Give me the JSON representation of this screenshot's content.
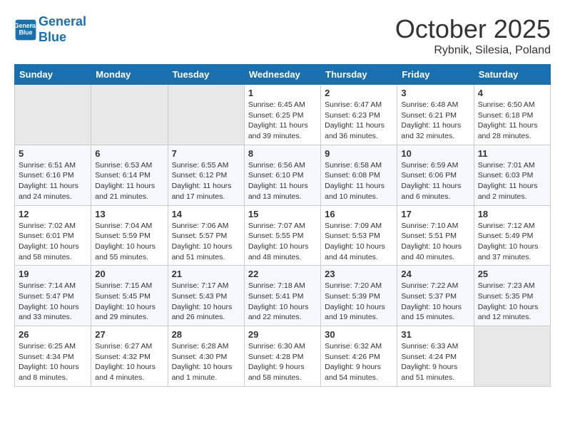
{
  "header": {
    "logo_line1": "General",
    "logo_line2": "Blue",
    "month": "October 2025",
    "location": "Rybnik, Silesia, Poland"
  },
  "weekdays": [
    "Sunday",
    "Monday",
    "Tuesday",
    "Wednesday",
    "Thursday",
    "Friday",
    "Saturday"
  ],
  "weeks": [
    [
      {
        "day": "",
        "info": ""
      },
      {
        "day": "",
        "info": ""
      },
      {
        "day": "",
        "info": ""
      },
      {
        "day": "1",
        "info": "Sunrise: 6:45 AM\nSunset: 6:25 PM\nDaylight: 11 hours\nand 39 minutes."
      },
      {
        "day": "2",
        "info": "Sunrise: 6:47 AM\nSunset: 6:23 PM\nDaylight: 11 hours\nand 36 minutes."
      },
      {
        "day": "3",
        "info": "Sunrise: 6:48 AM\nSunset: 6:21 PM\nDaylight: 11 hours\nand 32 minutes."
      },
      {
        "day": "4",
        "info": "Sunrise: 6:50 AM\nSunset: 6:18 PM\nDaylight: 11 hours\nand 28 minutes."
      }
    ],
    [
      {
        "day": "5",
        "info": "Sunrise: 6:51 AM\nSunset: 6:16 PM\nDaylight: 11 hours\nand 24 minutes."
      },
      {
        "day": "6",
        "info": "Sunrise: 6:53 AM\nSunset: 6:14 PM\nDaylight: 11 hours\nand 21 minutes."
      },
      {
        "day": "7",
        "info": "Sunrise: 6:55 AM\nSunset: 6:12 PM\nDaylight: 11 hours\nand 17 minutes."
      },
      {
        "day": "8",
        "info": "Sunrise: 6:56 AM\nSunset: 6:10 PM\nDaylight: 11 hours\nand 13 minutes."
      },
      {
        "day": "9",
        "info": "Sunrise: 6:58 AM\nSunset: 6:08 PM\nDaylight: 11 hours\nand 10 minutes."
      },
      {
        "day": "10",
        "info": "Sunrise: 6:59 AM\nSunset: 6:06 PM\nDaylight: 11 hours\nand 6 minutes."
      },
      {
        "day": "11",
        "info": "Sunrise: 7:01 AM\nSunset: 6:03 PM\nDaylight: 11 hours\nand 2 minutes."
      }
    ],
    [
      {
        "day": "12",
        "info": "Sunrise: 7:02 AM\nSunset: 6:01 PM\nDaylight: 10 hours\nand 58 minutes."
      },
      {
        "day": "13",
        "info": "Sunrise: 7:04 AM\nSunset: 5:59 PM\nDaylight: 10 hours\nand 55 minutes."
      },
      {
        "day": "14",
        "info": "Sunrise: 7:06 AM\nSunset: 5:57 PM\nDaylight: 10 hours\nand 51 minutes."
      },
      {
        "day": "15",
        "info": "Sunrise: 7:07 AM\nSunset: 5:55 PM\nDaylight: 10 hours\nand 48 minutes."
      },
      {
        "day": "16",
        "info": "Sunrise: 7:09 AM\nSunset: 5:53 PM\nDaylight: 10 hours\nand 44 minutes."
      },
      {
        "day": "17",
        "info": "Sunrise: 7:10 AM\nSunset: 5:51 PM\nDaylight: 10 hours\nand 40 minutes."
      },
      {
        "day": "18",
        "info": "Sunrise: 7:12 AM\nSunset: 5:49 PM\nDaylight: 10 hours\nand 37 minutes."
      }
    ],
    [
      {
        "day": "19",
        "info": "Sunrise: 7:14 AM\nSunset: 5:47 PM\nDaylight: 10 hours\nand 33 minutes."
      },
      {
        "day": "20",
        "info": "Sunrise: 7:15 AM\nSunset: 5:45 PM\nDaylight: 10 hours\nand 29 minutes."
      },
      {
        "day": "21",
        "info": "Sunrise: 7:17 AM\nSunset: 5:43 PM\nDaylight: 10 hours\nand 26 minutes."
      },
      {
        "day": "22",
        "info": "Sunrise: 7:18 AM\nSunset: 5:41 PM\nDaylight: 10 hours\nand 22 minutes."
      },
      {
        "day": "23",
        "info": "Sunrise: 7:20 AM\nSunset: 5:39 PM\nDaylight: 10 hours\nand 19 minutes."
      },
      {
        "day": "24",
        "info": "Sunrise: 7:22 AM\nSunset: 5:37 PM\nDaylight: 10 hours\nand 15 minutes."
      },
      {
        "day": "25",
        "info": "Sunrise: 7:23 AM\nSunset: 5:35 PM\nDaylight: 10 hours\nand 12 minutes."
      }
    ],
    [
      {
        "day": "26",
        "info": "Sunrise: 6:25 AM\nSunset: 4:34 PM\nDaylight: 10 hours\nand 8 minutes."
      },
      {
        "day": "27",
        "info": "Sunrise: 6:27 AM\nSunset: 4:32 PM\nDaylight: 10 hours\nand 4 minutes."
      },
      {
        "day": "28",
        "info": "Sunrise: 6:28 AM\nSunset: 4:30 PM\nDaylight: 10 hours\nand 1 minute."
      },
      {
        "day": "29",
        "info": "Sunrise: 6:30 AM\nSunset: 4:28 PM\nDaylight: 9 hours\nand 58 minutes."
      },
      {
        "day": "30",
        "info": "Sunrise: 6:32 AM\nSunset: 4:26 PM\nDaylight: 9 hours\nand 54 minutes."
      },
      {
        "day": "31",
        "info": "Sunrise: 6:33 AM\nSunset: 4:24 PM\nDaylight: 9 hours\nand 51 minutes."
      },
      {
        "day": "",
        "info": ""
      }
    ]
  ]
}
